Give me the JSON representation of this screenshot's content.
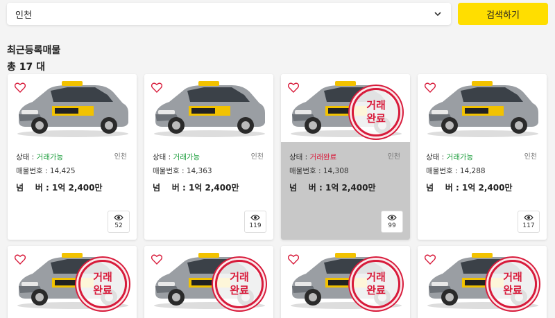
{
  "search": {
    "region_value": "인천",
    "button_label": "검색하기"
  },
  "section": {
    "title": "최근등록매물",
    "total": "총 17 대"
  },
  "colors": {
    "accent": "#ffde00",
    "available": "#1a9c3a",
    "completed": "#d81b3b"
  },
  "stamp_text": {
    "line1": "거래",
    "line2": "완료"
  },
  "labels": {
    "status_prefix": "상태 : ",
    "number_prefix": "매물번호 : ",
    "price_label": "넘    버 : "
  },
  "cards": [
    {
      "status": "거래가능",
      "region": "인천",
      "number": "14,425",
      "price": "1억 2,400만",
      "views": "52",
      "completed": false
    },
    {
      "status": "거래가능",
      "region": "인천",
      "number": "14,363",
      "price": "1억 2,400만",
      "views": "119",
      "completed": false
    },
    {
      "status": "거래완료",
      "region": "인천",
      "number": "14,308",
      "price": "1억 2,400만",
      "views": "99",
      "completed": true
    },
    {
      "status": "거래가능",
      "region": "인천",
      "number": "14,288",
      "price": "1억 2,400만",
      "views": "117",
      "completed": false
    },
    {
      "completed": true
    },
    {
      "completed": true
    },
    {
      "completed": true
    },
    {
      "completed": true
    }
  ]
}
